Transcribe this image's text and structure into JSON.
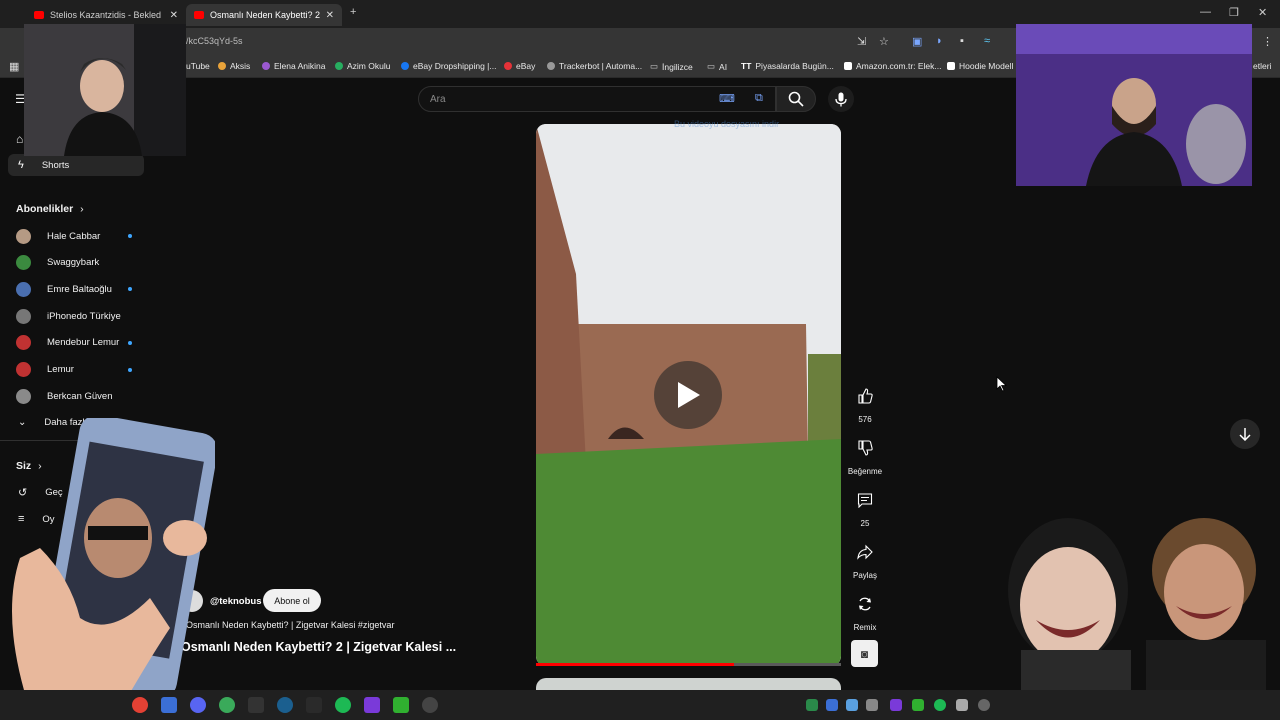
{
  "browser": {
    "tabs": [
      {
        "label": "Stelios Kazantzidis - Bekled"
      },
      {
        "label": "Osmanlı Neden Kaybetti? 2"
      }
    ],
    "new_tab": "+",
    "url": "/kcC53qYd-5s",
    "bookmarks": [
      {
        "label": "uTube"
      },
      {
        "label": "Aksis"
      },
      {
        "label": "Elena Anikina"
      },
      {
        "label": "Azim Okulu"
      },
      {
        "label": "eBay Dropshipping |..."
      },
      {
        "label": "eBay"
      },
      {
        "label": "Trackerbot | Automa..."
      },
      {
        "label": "İngilizce"
      },
      {
        "label": "AI"
      },
      {
        "label": "Piyasalarda Bugün..."
      },
      {
        "label": "Amazon.com.tr: Elek..."
      },
      {
        "label": "Hoodie Modell"
      },
      {
        "label": "etleri"
      }
    ]
  },
  "youtube": {
    "search_placeholder": "Ara",
    "download_hint": "Bu videoyu dosyasını indir",
    "sidebar": {
      "shorts": "Shorts",
      "subscriptions_heading": "Abonelikler",
      "subscriptions": [
        {
          "name": "Hale Cabbar",
          "dot": true,
          "color": "#b59a84"
        },
        {
          "name": "Swaggybark",
          "dot": false,
          "color": "#3b8a3f"
        },
        {
          "name": "Emre Baltaoğlu",
          "dot": true,
          "color": "#4a6fb0"
        },
        {
          "name": "iPhonedo Türkiye",
          "dot": false,
          "color": "#777777"
        },
        {
          "name": "Mendebur Lemur",
          "dot": true,
          "color": "#c03232"
        },
        {
          "name": "Lemur",
          "dot": true,
          "color": "#c03232"
        },
        {
          "name": "Berkcan Güven",
          "dot": false,
          "color": "#8a8a8a"
        }
      ],
      "more": "Daha fazla",
      "you_heading": "Siz",
      "history": "Geç",
      "playlists": "Oy"
    },
    "short": {
      "channel": "@teknobus",
      "subscribe": "Abone ol",
      "music": "Osmanlı Neden Kaybetti? | Zigetvar Kalesi #zigetvar",
      "title": "Osmanlı Neden Kaybetti? 2 | Zigetvar Kalesi ...",
      "progress": 0.65,
      "actions": {
        "like_count": "576",
        "dislike_label": "Beğenme",
        "comment_count": "25",
        "share_label": "Paylaş",
        "remix_label": "Remix"
      }
    }
  },
  "colors": {
    "background": "#0f0f0f",
    "accent_red": "#ff0000",
    "unread_dot": "#3ea6ff"
  }
}
